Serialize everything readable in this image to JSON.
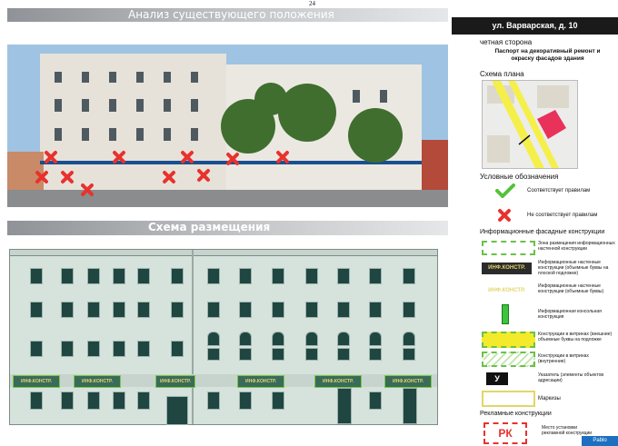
{
  "page_number": "24",
  "sections": {
    "analysis_title": "Анализ существующего положения",
    "scheme_title": "Схема размещения"
  },
  "address": "ул. Варварская, д. 10",
  "side": "четная сторона",
  "passport_title": "Паспорт на декоративный ремонт и окраску фасадов здания",
  "plan_title": "Схема плана",
  "legend": {
    "title": "Условные обозначения",
    "ok": "Соответствует правилам",
    "not_ok": "Не соответствует правилам",
    "facade_title": "Информационные фасадные конструкции",
    "items": {
      "zone": "Зона размещения информационных настенной конструкции",
      "wall_flat_chip": "ИНФ.КОНСТР.",
      "wall_flat": "Информационные настенные конструкции (объемные буквы на плоской подложке)",
      "wall_letters_chip": "ИНФ.КОНСТР.",
      "wall_letters": "Информационные настенные конструкции (объемные буквы)",
      "console": "Информационная консольная конструкция",
      "window_outer": "Конструкции в витринах (внешние) объемные буквы на подложке",
      "window_inner": "Конструкции в витринах (внутренние)",
      "pointer_chip": "У",
      "pointer": "Указатель (элементы объектов адресации)",
      "markiza": "Маркизы"
    },
    "ads_title": "Рекламные конструкции",
    "ads_chip": "РК",
    "ads": "Место установки рекламной конструкции"
  },
  "facade_signs": [
    "ИНФ.КОНСТР.",
    "ИНФ.КОНСТР.",
    "ИНФ.КОНСТР.",
    "ИНФ.КОНСТР.",
    "ИНФ.КОНСТР.",
    "ИНФ.КОНСТР."
  ],
  "watermark": "Pablo",
  "colors": {
    "red_x": "#e8322d",
    "green_ok": "#55c23a",
    "facade": "#d6e2dc",
    "window": "#1f4640",
    "sign_text": "#e2d66a"
  }
}
